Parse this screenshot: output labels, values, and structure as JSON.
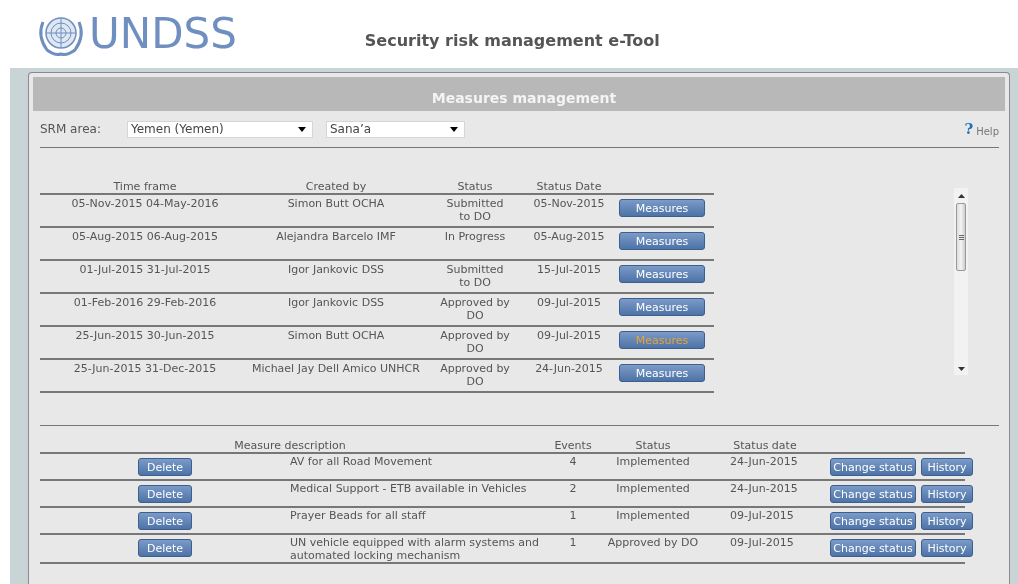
{
  "header": {
    "logo_text": "UNDSS",
    "title": "Security risk management e-Tool"
  },
  "panel": {
    "title": "Measures management",
    "srm_label": "SRM area:",
    "srm_country": "Yemen (Yemen)",
    "srm_city": "Sana’a",
    "help": {
      "icon": "?",
      "label": "Help"
    }
  },
  "periods": {
    "columns": [
      "Time frame",
      "Created by",
      "Status",
      "Status Date"
    ],
    "rows": [
      {
        "time_frame": "05-Nov-2015 04-May-2016",
        "created_by": "Simon Butt OCHA",
        "status": "Submitted to DO",
        "status_date": "05-Nov-2015",
        "button": "Measures",
        "selected": false
      },
      {
        "time_frame": "05-Aug-2015 06-Aug-2015",
        "created_by": "Alejandra Barcelo IMF",
        "status": "In Progress",
        "status_date": "05-Aug-2015",
        "button": "Measures",
        "selected": false
      },
      {
        "time_frame": "01-Jul-2015 31-Jul-2015",
        "created_by": "Igor Jankovic DSS",
        "status": "Submitted to DO",
        "status_date": "15-Jul-2015",
        "button": "Measures",
        "selected": false
      },
      {
        "time_frame": "01-Feb-2016 29-Feb-2016",
        "created_by": "Igor Jankovic DSS",
        "status": "Approved by DO",
        "status_date": "09-Jul-2015",
        "button": "Measures",
        "selected": false
      },
      {
        "time_frame": "25-Jun-2015 30-Jun-2015",
        "created_by": "Simon Butt OCHA",
        "status": "Approved by DO",
        "status_date": "09-Jul-2015",
        "button": "Measures",
        "selected": true
      },
      {
        "time_frame": "25-Jun-2015 31-Dec-2015",
        "created_by": "Michael Jay Dell Amico UNHCR",
        "status": "Approved by DO",
        "status_date": "24-Jun-2015",
        "button": "Measures",
        "selected": false
      }
    ]
  },
  "measures": {
    "columns": [
      "Measure description",
      "Events",
      "Status",
      "Status date"
    ],
    "rows": [
      {
        "delete": "Delete",
        "description": "AV for all Road Movement",
        "events": "4",
        "status": "Implemented",
        "status_date": "24-Jun-2015",
        "change": "Change status",
        "history": "History"
      },
      {
        "delete": "Delete",
        "description": "Medical Support - ETB available in Vehicles",
        "events": "2",
        "status": "Implemented",
        "status_date": "24-Jun-2015",
        "change": "Change status",
        "history": "History"
      },
      {
        "delete": "Delete",
        "description": "Prayer Beads for all staff",
        "events": "1",
        "status": "Implemented",
        "status_date": "09-Jul-2015",
        "change": "Change status",
        "history": "History"
      },
      {
        "delete": "Delete",
        "description": "UN vehicle equipped with alarm systems and automated locking mechanism",
        "events": "1",
        "status": "Approved by DO",
        "status_date": "09-Jul-2015",
        "change": "Change status",
        "history": "History"
      }
    ]
  }
}
